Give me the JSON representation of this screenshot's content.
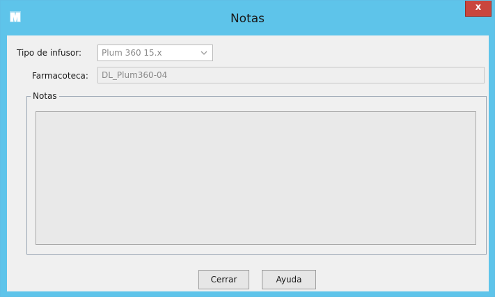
{
  "window": {
    "title": "Notas",
    "close_label": "x"
  },
  "form": {
    "infusor_label": "Tipo de infusor:",
    "infusor_value": "Plum 360 15.x",
    "farmacoteca_label": "Farmacoteca:",
    "farmacoteca_value": "DL_Plum360-04"
  },
  "notes_group": {
    "title": "Notas",
    "content": ""
  },
  "buttons": {
    "close": "Cerrar",
    "help": "Ayuda"
  },
  "icons": {
    "app": "app-logo-icon",
    "dropdown": "chevron-down-icon",
    "close": "close-icon"
  },
  "colors": {
    "titlebar": "#5ec4ea",
    "close_button": "#c9463d",
    "background": "#f0f0f0"
  }
}
